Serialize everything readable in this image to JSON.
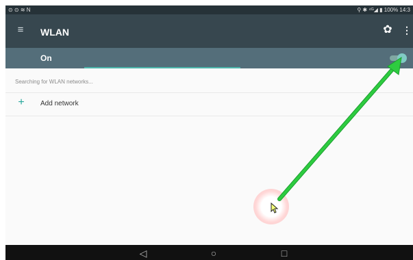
{
  "status_bar": {
    "left_icons": "⊙ ⊙ ≋ N",
    "right_text": "⚲ ✱ ⁴ᴳ◢ ▮ 100% 14:3"
  },
  "app_bar": {
    "menu_icon": "hamburger-menu-icon",
    "title": "WLAN",
    "settings_icon": "gear-icon",
    "overflow_icon": "more-vert-icon"
  },
  "switch_bar": {
    "label": "On",
    "toggle_state": "on",
    "accent_color": "#4db6ac"
  },
  "content": {
    "status_text": "Searching for WLAN networks...",
    "add_network": {
      "icon": "plus-icon",
      "label": "Add network"
    }
  },
  "nav_bar": {
    "back_icon": "back-triangle-icon",
    "home_icon": "home-circle-icon",
    "recents_icon": "recents-square-icon"
  },
  "annotation": {
    "arrow_color": "#2ecc40"
  }
}
